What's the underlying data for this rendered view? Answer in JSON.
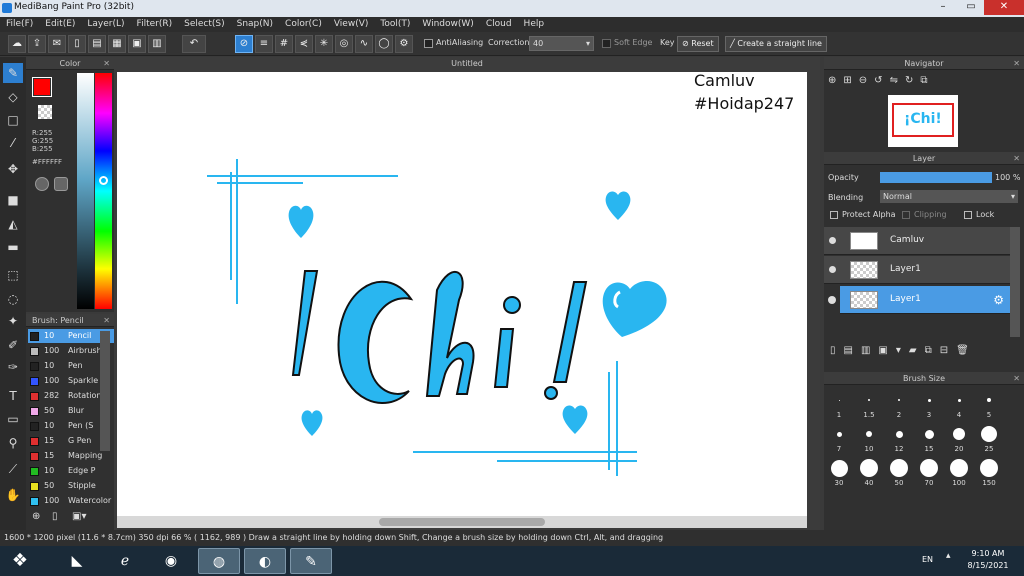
{
  "window": {
    "title": "MediBang Paint Pro (32bit)"
  },
  "menu": [
    "File(F)",
    "Edit(E)",
    "Layer(L)",
    "Filter(R)",
    "Select(S)",
    "Snap(N)",
    "Color(C)",
    "View(V)",
    "Tool(T)",
    "Window(W)",
    "Cloud",
    "Help"
  ],
  "toolbar": {
    "antialiasing_label": "AntiAliasing",
    "correction_label": "Correction",
    "correction_value": "40",
    "soft_edge_label": "Soft Edge",
    "key_label": "Key",
    "reset_label": "Reset",
    "straight_line_label": "Create a straight line"
  },
  "color_panel": {
    "title": "Color",
    "r": "R:255",
    "g": "G:255",
    "b": "B:255",
    "hex": "#FFFFFF",
    "primary_color": "#ff0000",
    "secondary_color": "#ffffff"
  },
  "brush_panel": {
    "title": "Brush: Pencil",
    "items": [
      {
        "size": "10",
        "name": "Pencil",
        "color": "#222222"
      },
      {
        "size": "100",
        "name": "Airbrush",
        "color": "#bbbbbb"
      },
      {
        "size": "10",
        "name": "Pen",
        "color": "#222222"
      },
      {
        "size": "100",
        "name": "Sparkle",
        "color": "#3355ff"
      },
      {
        "size": "282",
        "name": "Rotation",
        "color": "#e03030"
      },
      {
        "size": "50",
        "name": "Blur",
        "color": "#f0a8e8"
      },
      {
        "size": "10",
        "name": "Pen (S",
        "color": "#222222"
      },
      {
        "size": "15",
        "name": "G Pen",
        "color": "#e03030"
      },
      {
        "size": "15",
        "name": "Mapping",
        "color": "#e03030"
      },
      {
        "size": "10",
        "name": "Edge P",
        "color": "#22bb22"
      },
      {
        "size": "50",
        "name": "Stipple",
        "color": "#e8e020"
      },
      {
        "size": "100",
        "name": "Watercolor",
        "color": "#30c0f0"
      }
    ]
  },
  "canvas": {
    "tab_title": "Untitled",
    "text_line1": "Camluv",
    "text_line2": "#Hoidap247",
    "artwork_text": "¡Chi!"
  },
  "navigator": {
    "title": "Navigator"
  },
  "layer_panel": {
    "title": "Layer",
    "opacity_label": "Opacity",
    "opacity_value": "100 %",
    "opacity_fraction": 1.0,
    "blending_label": "Blending",
    "blending_value": "Normal",
    "protect_alpha_label": "Protect Alpha",
    "clipping_label": "Clipping",
    "lock_label": "Lock",
    "layers": [
      {
        "name": "Camluv"
      },
      {
        "name": "Layer1"
      },
      {
        "name": "Layer1"
      }
    ]
  },
  "brush_size": {
    "title": "Brush Size",
    "sizes": [
      "1",
      "1.5",
      "2",
      "3",
      "4",
      "5",
      "7",
      "10",
      "12",
      "15",
      "20",
      "25",
      "30",
      "40",
      "50",
      "70",
      "100",
      "150"
    ]
  },
  "status": "1600 * 1200 pixel   (11.6 * 8.7cm)   350 dpi   66 %   ( 1162, 989 )   Draw a straight line by holding down Shift, Change a brush size by holding down Ctrl, Alt, and dragging",
  "taskbar": {
    "lang": "EN",
    "time": "9:10 AM",
    "date": "8/15/2021"
  },
  "colors": {
    "accent": "#4a9be4",
    "artwork_blue": "#29b6f0"
  }
}
